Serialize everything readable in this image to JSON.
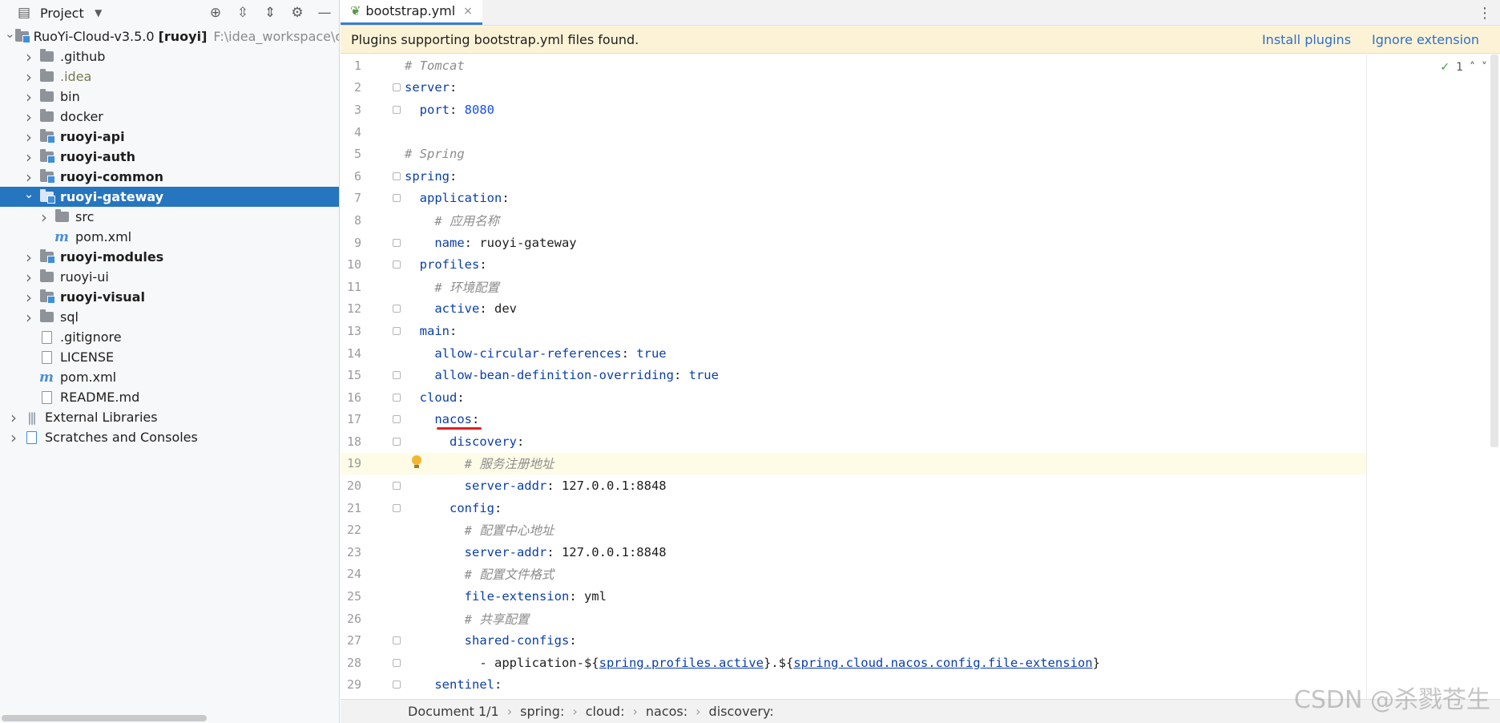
{
  "panel": {
    "title": "Project",
    "tools": [
      "locate-icon",
      "expand-all-icon",
      "collapse-all-icon",
      "settings-icon",
      "minimize-icon"
    ]
  },
  "tree": [
    {
      "label": "RuoYi-Cloud-v3.5.0",
      "suffix": "[ruoyi]",
      "path": "F:\\idea_workspace\\ope",
      "depth": 0,
      "chev": "v",
      "icon": "module-folder",
      "bold": false
    },
    {
      "label": ".github",
      "depth": 1,
      "chev": ">",
      "icon": "folder",
      "bold": false
    },
    {
      "label": ".idea",
      "depth": 1,
      "chev": ">",
      "icon": "folder",
      "bold": false,
      "muted": true
    },
    {
      "label": "bin",
      "depth": 1,
      "chev": ">",
      "icon": "folder",
      "bold": false
    },
    {
      "label": "docker",
      "depth": 1,
      "chev": ">",
      "icon": "folder",
      "bold": false
    },
    {
      "label": "ruoyi-api",
      "depth": 1,
      "chev": ">",
      "icon": "module-folder",
      "bold": true
    },
    {
      "label": "ruoyi-auth",
      "depth": 1,
      "chev": ">",
      "icon": "module-folder",
      "bold": true
    },
    {
      "label": "ruoyi-common",
      "depth": 1,
      "chev": ">",
      "icon": "module-folder",
      "bold": true
    },
    {
      "label": "ruoyi-gateway",
      "depth": 1,
      "chev": "v",
      "icon": "module-folder",
      "bold": true,
      "selected": true
    },
    {
      "label": "src",
      "depth": 2,
      "chev": ">",
      "icon": "folder",
      "bold": false
    },
    {
      "label": "pom.xml",
      "depth": 2,
      "chev": "",
      "icon": "maven",
      "bold": false
    },
    {
      "label": "ruoyi-modules",
      "depth": 1,
      "chev": ">",
      "icon": "module-folder",
      "bold": true
    },
    {
      "label": "ruoyi-ui",
      "depth": 1,
      "chev": ">",
      "icon": "folder",
      "bold": false
    },
    {
      "label": "ruoyi-visual",
      "depth": 1,
      "chev": ">",
      "icon": "module-folder",
      "bold": true
    },
    {
      "label": "sql",
      "depth": 1,
      "chev": ">",
      "icon": "folder",
      "bold": false
    },
    {
      "label": ".gitignore",
      "depth": 1,
      "chev": "",
      "icon": "file",
      "bold": false
    },
    {
      "label": "LICENSE",
      "depth": 1,
      "chev": "",
      "icon": "file",
      "bold": false
    },
    {
      "label": "pom.xml",
      "depth": 1,
      "chev": "",
      "icon": "maven",
      "bold": false
    },
    {
      "label": "README.md",
      "depth": 1,
      "chev": "",
      "icon": "file",
      "bold": false
    },
    {
      "label": "External Libraries",
      "depth": 0,
      "chev": ">",
      "icon": "library",
      "bold": false
    },
    {
      "label": "Scratches and Consoles",
      "depth": 0,
      "chev": ">",
      "icon": "scratch",
      "bold": false
    }
  ],
  "tab": {
    "label": "bootstrap.yml",
    "close": "×"
  },
  "banner": {
    "message": "Plugins supporting bootstrap.yml files found.",
    "install": "Install plugins",
    "ignore": "Ignore extension"
  },
  "inspection": {
    "count": "1"
  },
  "code": [
    {
      "n": "1",
      "parts": [
        [
          "c",
          "# Tomcat"
        ]
      ]
    },
    {
      "n": "2",
      "parts": [
        [
          "k",
          "server"
        ],
        [
          "t",
          ":"
        ]
      ],
      "fold": true
    },
    {
      "n": "3",
      "parts": [
        [
          "t",
          "  "
        ],
        [
          "k",
          "port"
        ],
        [
          "t",
          ": "
        ],
        [
          "n",
          "8080"
        ]
      ],
      "fold": true
    },
    {
      "n": "4",
      "parts": []
    },
    {
      "n": "5",
      "parts": [
        [
          "c",
          "# Spring"
        ]
      ]
    },
    {
      "n": "6",
      "parts": [
        [
          "k",
          "spring"
        ],
        [
          "t",
          ":"
        ]
      ],
      "fold": true
    },
    {
      "n": "7",
      "parts": [
        [
          "t",
          "  "
        ],
        [
          "k",
          "application"
        ],
        [
          "t",
          ":"
        ]
      ],
      "fold": true
    },
    {
      "n": "8",
      "parts": [
        [
          "t",
          "    "
        ],
        [
          "c",
          "# 应用名称"
        ]
      ]
    },
    {
      "n": "9",
      "parts": [
        [
          "t",
          "    "
        ],
        [
          "k",
          "name"
        ],
        [
          "t",
          ": ruoyi-gateway"
        ]
      ],
      "fold": true
    },
    {
      "n": "10",
      "parts": [
        [
          "t",
          "  "
        ],
        [
          "k",
          "profiles"
        ],
        [
          "t",
          ":"
        ]
      ],
      "fold": true
    },
    {
      "n": "11",
      "parts": [
        [
          "t",
          "    "
        ],
        [
          "c",
          "# 环境配置"
        ]
      ]
    },
    {
      "n": "12",
      "parts": [
        [
          "t",
          "    "
        ],
        [
          "k",
          "active"
        ],
        [
          "t",
          ": dev"
        ]
      ],
      "fold": true
    },
    {
      "n": "13",
      "parts": [
        [
          "t",
          "  "
        ],
        [
          "k",
          "main"
        ],
        [
          "t",
          ":"
        ]
      ],
      "fold": true
    },
    {
      "n": "14",
      "parts": [
        [
          "t",
          "    "
        ],
        [
          "k",
          "allow-circular-references"
        ],
        [
          "t",
          ": "
        ],
        [
          "k",
          "true"
        ]
      ]
    },
    {
      "n": "15",
      "parts": [
        [
          "t",
          "    "
        ],
        [
          "k",
          "allow-bean-definition-overriding"
        ],
        [
          "t",
          ": "
        ],
        [
          "k",
          "true"
        ]
      ],
      "fold": true
    },
    {
      "n": "16",
      "parts": [
        [
          "t",
          "  "
        ],
        [
          "k",
          "cloud"
        ],
        [
          "t",
          ":"
        ]
      ],
      "fold": true
    },
    {
      "n": "17",
      "parts": [
        [
          "t",
          "    "
        ],
        [
          "k",
          "nacos"
        ],
        [
          "t",
          ":"
        ]
      ],
      "fold": true
    },
    {
      "n": "18",
      "parts": [
        [
          "t",
          "      "
        ],
        [
          "k",
          "discovery"
        ],
        [
          "t",
          ":"
        ]
      ],
      "fold": true
    },
    {
      "n": "19",
      "parts": [
        [
          "t",
          "        "
        ],
        [
          "c",
          "# 服务注册地址"
        ]
      ],
      "highlight": true,
      "bulb": true
    },
    {
      "n": "20",
      "parts": [
        [
          "t",
          "        "
        ],
        [
          "k",
          "server-addr"
        ],
        [
          "t",
          ": 127.0.0.1:8848"
        ]
      ],
      "fold": true
    },
    {
      "n": "21",
      "parts": [
        [
          "t",
          "      "
        ],
        [
          "k",
          "config"
        ],
        [
          "t",
          ":"
        ]
      ],
      "fold": true
    },
    {
      "n": "22",
      "parts": [
        [
          "t",
          "        "
        ],
        [
          "c",
          "# 配置中心地址"
        ]
      ]
    },
    {
      "n": "23",
      "parts": [
        [
          "t",
          "        "
        ],
        [
          "k",
          "server-addr"
        ],
        [
          "t",
          ": 127.0.0.1:8848"
        ]
      ]
    },
    {
      "n": "24",
      "parts": [
        [
          "t",
          "        "
        ],
        [
          "c",
          "# 配置文件格式"
        ]
      ]
    },
    {
      "n": "25",
      "parts": [
        [
          "t",
          "        "
        ],
        [
          "k",
          "file-extension"
        ],
        [
          "t",
          ": yml"
        ]
      ]
    },
    {
      "n": "26",
      "parts": [
        [
          "t",
          "        "
        ],
        [
          "c",
          "# 共享配置"
        ]
      ]
    },
    {
      "n": "27",
      "parts": [
        [
          "t",
          "        "
        ],
        [
          "k",
          "shared-configs"
        ],
        [
          "t",
          ":"
        ]
      ],
      "fold": true
    },
    {
      "n": "28",
      "parts": [
        [
          "t",
          "          - application-${"
        ],
        [
          "u",
          "spring.profiles.active"
        ],
        [
          "t",
          "}.${"
        ],
        [
          "u",
          "spring.cloud.nacos.config.file-extension"
        ],
        [
          "t",
          "}"
        ]
      ],
      "fold": true
    },
    {
      "n": "29",
      "parts": [
        [
          "t",
          "    "
        ],
        [
          "k",
          "sentinel"
        ],
        [
          "t",
          ":"
        ]
      ],
      "fold": true
    }
  ],
  "status": {
    "document": "Document 1/1",
    "crumbs": [
      "spring:",
      "cloud:",
      "nacos:",
      "discovery:"
    ]
  },
  "watermark": "CSDN @杀戮苍生",
  "colors": {
    "selection": "#2675bf",
    "banner_bg": "#fcf3d7",
    "keyword": "#0b3fa8",
    "comment": "#8c8c8c",
    "number": "#1750eb",
    "link": "#2f6fc8"
  }
}
